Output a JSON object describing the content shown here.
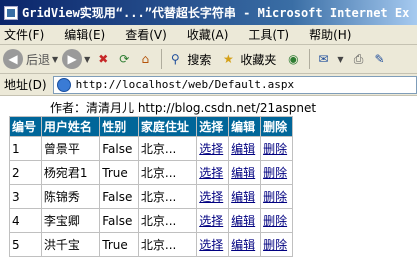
{
  "window": {
    "title": "GridView实现用“...”代替超长字符串 - Microsoft Internet Ex"
  },
  "menu": [
    "文件(F)",
    "编辑(E)",
    "查看(V)",
    "收藏(A)",
    "工具(T)",
    "帮助(H)"
  ],
  "toolbar": {
    "back_label": "后退",
    "search_label": "搜索",
    "favorites_label": "收藏夹"
  },
  "address": {
    "label": "地址(D)",
    "url": "http://localhost/web/Default.aspx"
  },
  "page": {
    "author_line": "作者：清清月儿 http://blog.csdn.net/21aspnet"
  },
  "grid": {
    "headers": [
      "编号",
      "用户姓名",
      "性别",
      "家庭住址",
      "选择",
      "编辑",
      "删除"
    ],
    "rows": [
      {
        "id": "1",
        "name": "曾景平",
        "gender": "False",
        "address": "北京...",
        "select": "选择",
        "edit": "编辑",
        "delete": "删除"
      },
      {
        "id": "2",
        "name": "杨宛君1",
        "gender": "True",
        "address": "北京...",
        "select": "选择",
        "edit": "编辑",
        "delete": "删除"
      },
      {
        "id": "3",
        "name": "陈锦秀",
        "gender": "False",
        "address": "北京...",
        "select": "选择",
        "edit": "编辑",
        "delete": "删除"
      },
      {
        "id": "4",
        "name": "李宝卿",
        "gender": "False",
        "address": "北京...",
        "select": "选择",
        "edit": "编辑",
        "delete": "删除"
      },
      {
        "id": "5",
        "name": "洪千宝",
        "gender": "True",
        "address": "北京...",
        "select": "选择",
        "edit": "编辑",
        "delete": "删除"
      }
    ]
  },
  "colors": {
    "header_bg": "#006699",
    "titlebar": "#0a246a",
    "chrome": "#ece9d8"
  }
}
